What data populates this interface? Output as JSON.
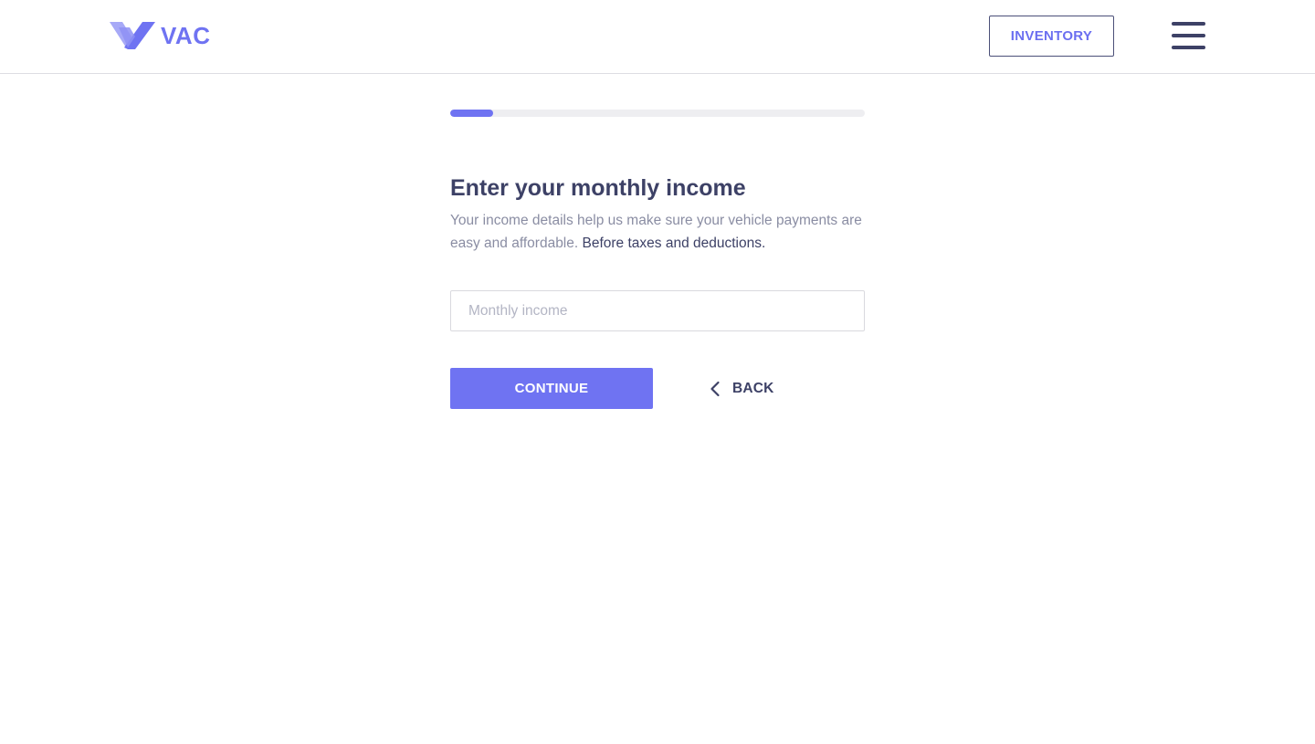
{
  "header": {
    "logo_text": "VAC",
    "inventory_label": "INVENTORY",
    "menu_icon": "hamburger-menu-icon"
  },
  "progress": {
    "fraction": 0.104
  },
  "form": {
    "title": "Enter your monthly income",
    "description": "Your income details help us make sure your vehicle payments are easy and affordable.",
    "description_emphasis": "Before taxes and deductions.",
    "income_placeholder": "Monthly income",
    "income_value": "",
    "continue_label": "CONTINUE",
    "back_label": "BACK",
    "back_icon": "chevron-left-icon"
  },
  "colors": {
    "accent": "#6f73f2",
    "text_dark": "#3d4166",
    "text_muted": "#8a8da3",
    "track": "#eeeef1"
  }
}
